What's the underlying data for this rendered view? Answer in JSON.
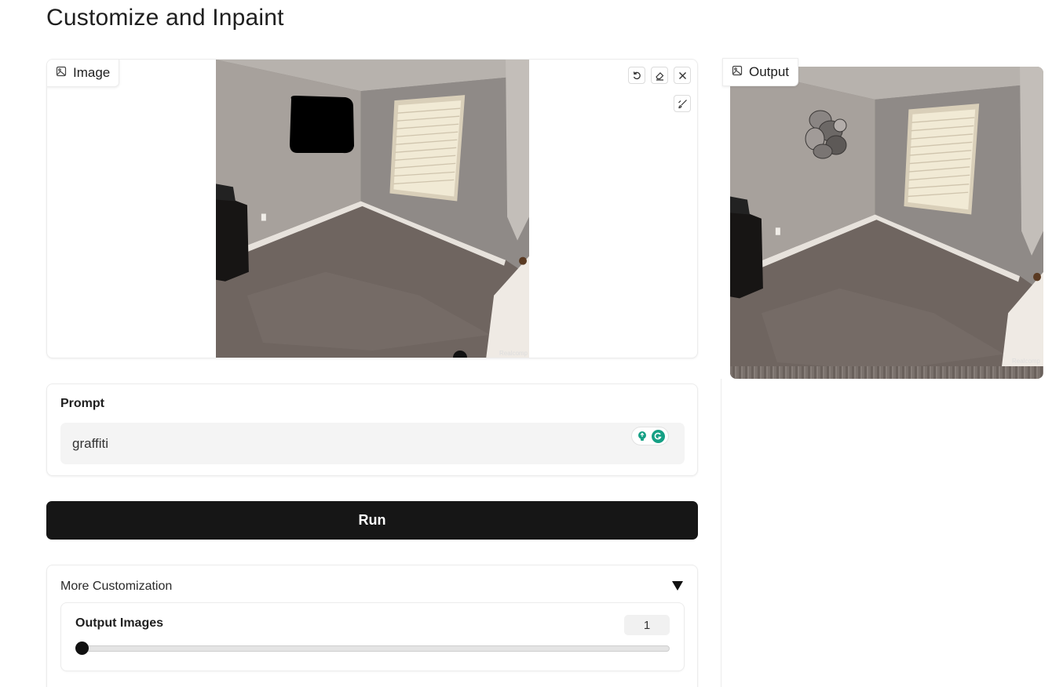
{
  "page": {
    "title": "Customize and Inpaint"
  },
  "image_panel": {
    "label": "Image",
    "tools": {
      "undo": "undo-icon",
      "erase": "eraser-icon",
      "clear": "close-icon",
      "brush": "brush-icon"
    },
    "watermark": "Realcomp"
  },
  "output_panel": {
    "label": "Output",
    "watermark": "Realcomp"
  },
  "prompt": {
    "label": "Prompt",
    "value": "graffiti"
  },
  "run": {
    "label": "Run"
  },
  "more": {
    "title": "More Customization",
    "output_images": {
      "label": "Output Images",
      "value": "1",
      "slider_fraction": 0.0
    }
  },
  "colors": {
    "accent": "#161616",
    "extension_green": "#16a085"
  }
}
